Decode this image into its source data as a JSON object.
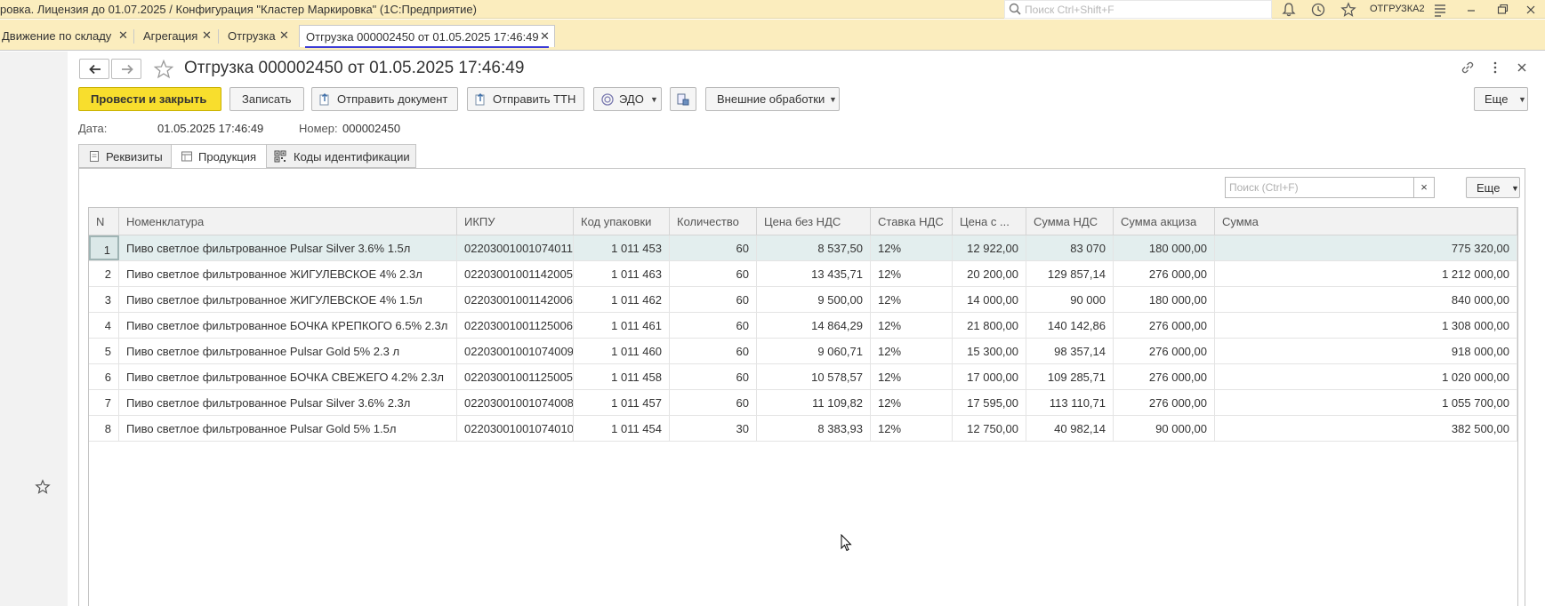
{
  "window": {
    "title": "ровка. Лицензия до 01.07.2025 / Конфигурация \"Кластер Маркировка\"  (1С:Предприятие)",
    "search_placeholder": "Поиск Ctrl+Shift+F",
    "user": "ОТГРУЗКА2"
  },
  "open_tabs": [
    {
      "label": "Движение по складу"
    },
    {
      "label": "Агрегация"
    },
    {
      "label": "Отгрузка"
    },
    {
      "label": "Отгрузка 000002450 от 01.05.2025 17:46:49"
    }
  ],
  "form": {
    "title": "Отгрузка 000002450 от 01.05.2025 17:46:49",
    "toolbar": {
      "post_close": "Провести и закрыть",
      "write": "Записать",
      "send_doc": "Отправить документ",
      "send_ttn": "Отправить ТТН",
      "edo": "ЭДО",
      "external": "Внешние обработки",
      "more": "Еще"
    },
    "date_label": "Дата:",
    "date_value": "01.05.2025 17:46:49",
    "number_label": "Номер:",
    "number_value": "000002450"
  },
  "page_tabs": [
    {
      "label": "Реквизиты"
    },
    {
      "label": "Продукция"
    },
    {
      "label": "Коды идентификации"
    }
  ],
  "grid": {
    "search_placeholder": "Поиск (Ctrl+F)",
    "clear": "×",
    "more": "Еще",
    "headers": [
      "N",
      "Номенклатура",
      "ИКПУ",
      "Код упаковки",
      "Количество",
      "Цена без НДС",
      "Ставка НДС",
      "Цена с ...",
      "Сумма НДС",
      "Сумма акциза",
      "Сумма"
    ],
    "rows": [
      [
        "1",
        "Пиво светлое фильтрованное Pulsar Silver 3.6% 1.5л",
        "02203001001074011",
        "1 011 453",
        "60",
        "8 537,50",
        "12%",
        "12 922,00",
        "83 070",
        "180 000,00",
        "775 320,00"
      ],
      [
        "2",
        "Пиво светлое фильтрованное ЖИГУЛЕВСКОЕ 4% 2.3л",
        "02203001001142005",
        "1 011 463",
        "60",
        "13 435,71",
        "12%",
        "20 200,00",
        "129 857,14",
        "276 000,00",
        "1 212 000,00"
      ],
      [
        "3",
        "Пиво светлое фильтрованное ЖИГУЛЕВСКОЕ 4% 1.5л",
        "02203001001142006",
        "1 011 462",
        "60",
        "9 500,00",
        "12%",
        "14 000,00",
        "90 000",
        "180 000,00",
        "840 000,00"
      ],
      [
        "4",
        "Пиво светлое фильтрованное БОЧКА КРЕПКОГО  6.5% 2.3л",
        "02203001001125006",
        "1 011 461",
        "60",
        "14 864,29",
        "12%",
        "21 800,00",
        "140 142,86",
        "276 000,00",
        "1 308 000,00"
      ],
      [
        "5",
        "Пиво светлое фильтрованное Pulsar Gold 5% 2.3 л",
        "02203001001074009",
        "1 011 460",
        "60",
        "9 060,71",
        "12%",
        "15 300,00",
        "98 357,14",
        "276 000,00",
        "918 000,00"
      ],
      [
        "6",
        "Пиво светлое фильтрованное БОЧКА СВЕЖЕГО 4.2% 2.3л",
        "02203001001125005",
        "1 011 458",
        "60",
        "10 578,57",
        "12%",
        "17 000,00",
        "109 285,71",
        "276 000,00",
        "1 020 000,00"
      ],
      [
        "7",
        "Пиво светлое фильтрованное Pulsar Silver 3.6% 2.3л",
        "02203001001074008",
        "1 011 457",
        "60",
        "11 109,82",
        "12%",
        "17 595,00",
        "113 110,71",
        "276 000,00",
        "1 055 700,00"
      ],
      [
        "8",
        "Пиво светлое фильтрованное Pulsar Gold 5%  1.5л",
        "02203001001074010",
        "1 011 454",
        "30",
        "8 383,93",
        "12%",
        "12 750,00",
        "40 982,14",
        "90 000,00",
        "382 500,00"
      ]
    ]
  },
  "colors": {
    "titlebar_bg": "#fbedbe",
    "primary_button": "#f8de2d",
    "selected_row": "#e3eeee",
    "active_tab_underline": "#3b3bd6"
  }
}
